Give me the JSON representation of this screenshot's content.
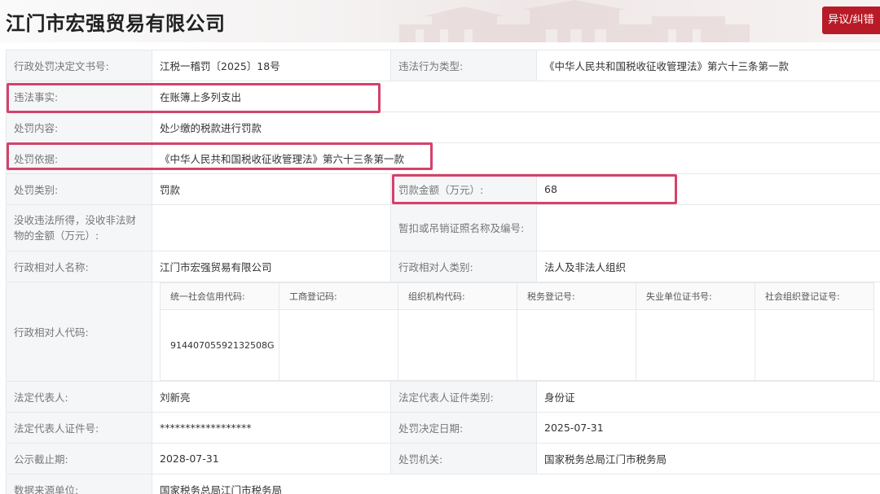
{
  "header": {
    "company_name": "江门市宏强贸易有限公司",
    "objection_button": "异议/纠错"
  },
  "rows": {
    "doc_no": {
      "label": "行政处罚决定文书号:",
      "value": "江税一稽罚〔2025〕18号"
    },
    "violation_type": {
      "label": "违法行为类型:",
      "value": "《中华人民共和国税收征收管理法》第六十三条第一款"
    },
    "violation_fact": {
      "label": "违法事实:",
      "value": "在账簿上多列支出"
    },
    "penalty_content": {
      "label": "处罚内容:",
      "value": "处少缴的税款进行罚款"
    },
    "penalty_basis": {
      "label": "处罚依据:",
      "value": "《中华人民共和国税收征收管理法》第六十三条第一款"
    },
    "penalty_category": {
      "label": "处罚类别:",
      "value": "罚款"
    },
    "fine_amount": {
      "label": "罚款金额（万元）:",
      "value": "68"
    },
    "confiscated": {
      "label": "没收违法所得，没收非法财物的金额（万元）:",
      "value": ""
    },
    "license_suspend": {
      "label": "暂扣或吊销证照名称及编号:",
      "value": ""
    },
    "party_name": {
      "label": "行政相对人名称:",
      "value": "江门市宏强贸易有限公司"
    },
    "party_type": {
      "label": "行政相对人类别:",
      "value": "法人及非法人组织"
    },
    "party_code": {
      "label": "行政相对人代码:"
    },
    "legal_rep": {
      "label": "法定代表人:",
      "value": "刘新亮"
    },
    "legal_rep_id_type": {
      "label": "法定代表人证件类别:",
      "value": "身份证"
    },
    "legal_rep_id_no": {
      "label": "法定代表人证件号:",
      "value": "******************"
    },
    "decision_date": {
      "label": "处罚决定日期:",
      "value": "2025-07-31"
    },
    "publicity_deadline": {
      "label": "公示截止期:",
      "value": "2028-07-31"
    },
    "authority": {
      "label": "处罚机关:",
      "value": "国家税务总局江门市税务局"
    },
    "data_source": {
      "label": "数据来源单位:",
      "value": "国家税务总局江门市税务局"
    }
  },
  "code_grid": {
    "headers": [
      "统一社会信用代码:",
      "工商登记码:",
      "组织机构代码:",
      "税务登记号:",
      "失业单位证书号:",
      "社会组织登记证号:"
    ],
    "values": [
      "91440705592132508G",
      "",
      "",
      "",
      "",
      ""
    ]
  },
  "colors": {
    "accent_red": "#b81b27",
    "highlight": "#d4426a"
  }
}
